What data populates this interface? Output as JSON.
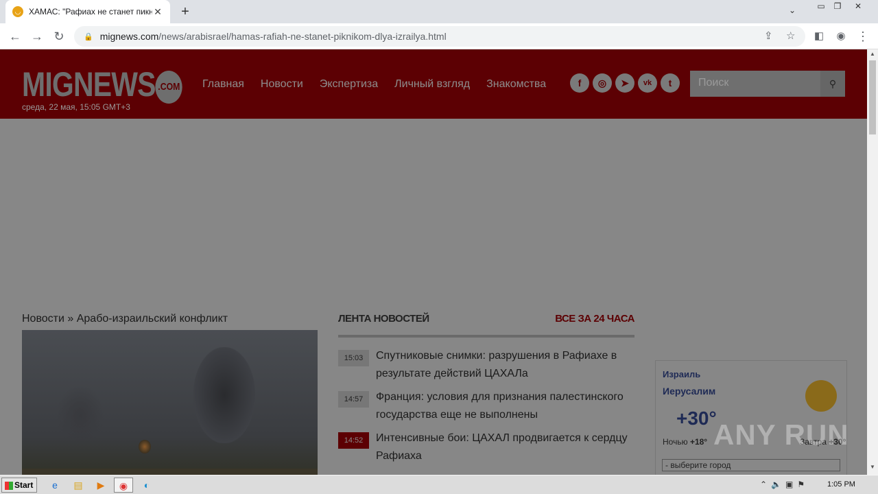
{
  "browser": {
    "tab_title": "ХАМАС: \"Рафиах не станет пикни",
    "tab_favicon": "mignews-favicon",
    "url_domain": "mignews.com",
    "url_path": "/news/arabisrael/hamas-rafiah-ne-stanet-piknikom-dlya-izrailya.html"
  },
  "site": {
    "logo_text": "MIGNEWS",
    "logo_com": ".COM",
    "date": "среда, 22 мая, 15:05 GMT+3",
    "nav": [
      "Главная",
      "Новости",
      "Экспертиза",
      "Личный взгляд",
      "Знакомства"
    ],
    "social": [
      "f",
      "◎",
      "➤",
      "vk",
      "t"
    ],
    "search_placeholder": "Поиск",
    "colors": {
      "header_bg": "#5c0003",
      "accent": "#5c0003"
    }
  },
  "article": {
    "breadcrumb": "Новости » Арабо-израильский конфликт"
  },
  "feed": {
    "title": "ЛЕНТА НОВОСТЕЙ",
    "all_link": "ВСЕ ЗА 24 ЧАСА",
    "items": [
      {
        "time": "15:03",
        "text": "Спутниковые снимки: разрушения в Рафиахе в результате действий ЦАХАЛа",
        "highlight": false
      },
      {
        "time": "14:57",
        "text": "Франция: условия для признания палестинского государства еще не выполнены",
        "highlight": false
      },
      {
        "time": "14:52",
        "text": "Интенсивные бои: ЦАХАЛ продвигается к сердцу Рафиаха",
        "highlight": true
      }
    ]
  },
  "weather": {
    "country": "Израиль",
    "city": "Иерусалим",
    "temp": "+30°",
    "night_label": "Ночью",
    "night_temp": "+18°",
    "tomorrow_label": "Завтра",
    "tomorrow_temp": "+30°",
    "select_value": "- выберите город"
  },
  "watermark": "ANY RUN",
  "taskbar": {
    "start_label": "Start",
    "clock": "1:05 PM"
  }
}
